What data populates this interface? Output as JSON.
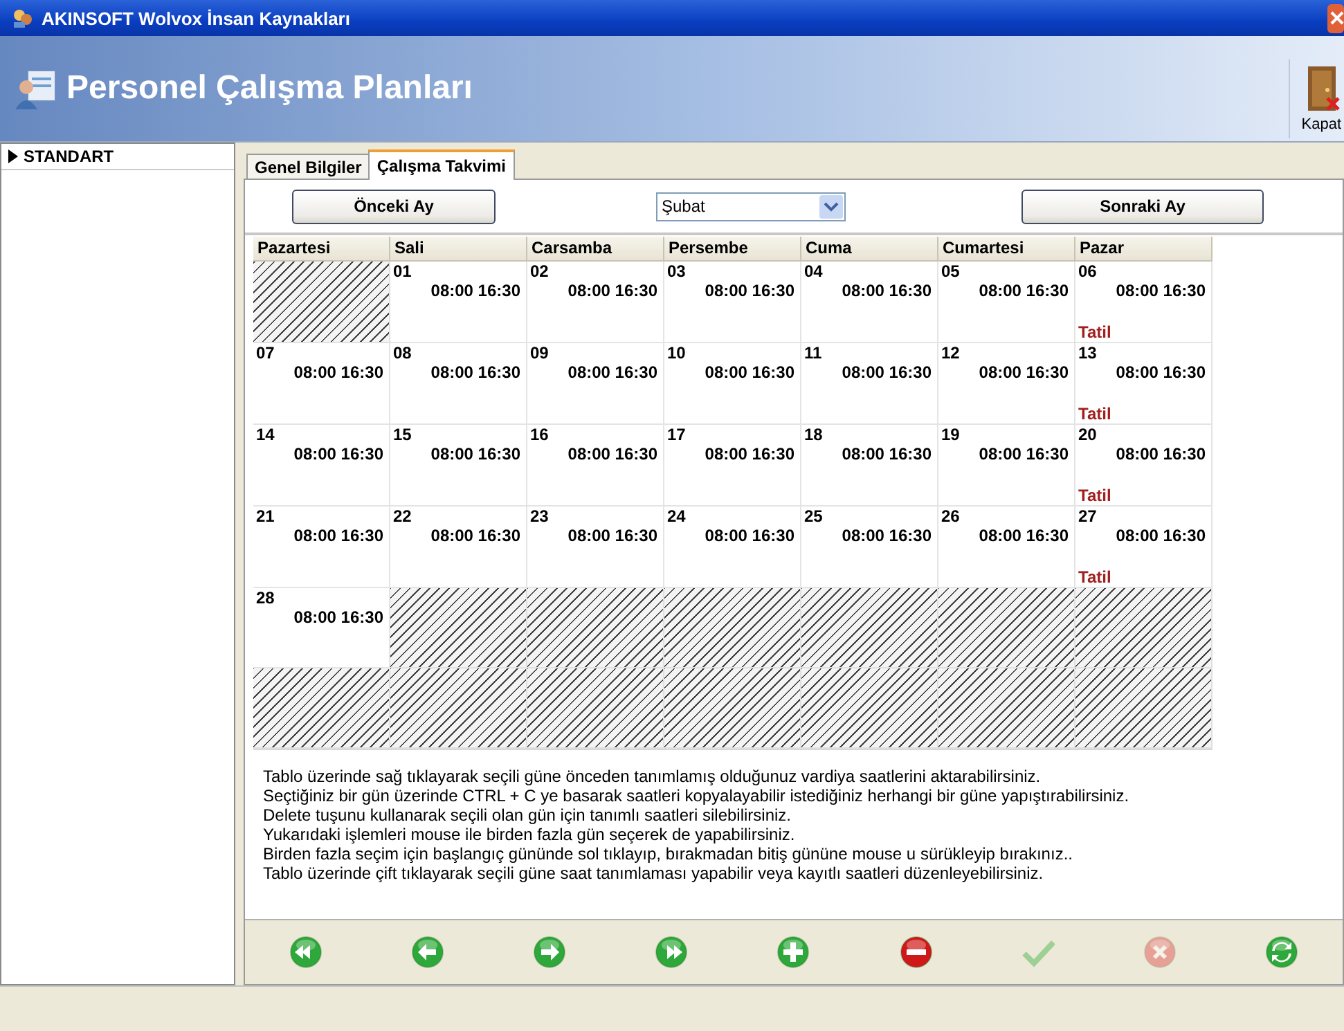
{
  "window": {
    "title": "AKINSOFT Wolvox İnsan Kaynakları"
  },
  "header": {
    "title": "Personel Çalışma Planları",
    "close_label": "Kapat"
  },
  "sidebar": {
    "items": [
      {
        "label": "STANDART",
        "selected": true
      }
    ]
  },
  "tabs": [
    {
      "label": "Genel Bilgiler",
      "selected": false
    },
    {
      "label": "Çalışma Takvimi",
      "selected": true
    }
  ],
  "month_nav": {
    "previous": "Önceki Ay",
    "month": "Şubat",
    "next": "Sonraki Ay"
  },
  "calendar": {
    "columns": [
      "Pazartesi",
      "Sali",
      "Carsamba",
      "Persembe",
      "Cuma",
      "Cumartesi",
      "Pazar"
    ],
    "weeks": [
      [
        {
          "kind": "blank"
        },
        {
          "kind": "day",
          "day": "01",
          "hours": "08:00 16:30"
        },
        {
          "kind": "day",
          "day": "02",
          "hours": "08:00 16:30"
        },
        {
          "kind": "day",
          "day": "03",
          "hours": "08:00 16:30"
        },
        {
          "kind": "day",
          "day": "04",
          "hours": "08:00 16:30"
        },
        {
          "kind": "day",
          "day": "05",
          "hours": "08:00 16:30"
        },
        {
          "kind": "day",
          "day": "06",
          "hours": "08:00 16:30",
          "note": "Tatil"
        }
      ],
      [
        {
          "kind": "day",
          "day": "07",
          "hours": "08:00 16:30"
        },
        {
          "kind": "day",
          "day": "08",
          "hours": "08:00 16:30"
        },
        {
          "kind": "day",
          "day": "09",
          "hours": "08:00 16:30"
        },
        {
          "kind": "day",
          "day": "10",
          "hours": "08:00 16:30"
        },
        {
          "kind": "day",
          "day": "11",
          "hours": "08:00 16:30"
        },
        {
          "kind": "day",
          "day": "12",
          "hours": "08:00 16:30"
        },
        {
          "kind": "day",
          "day": "13",
          "hours": "08:00 16:30",
          "note": "Tatil"
        }
      ],
      [
        {
          "kind": "day",
          "day": "14",
          "hours": "08:00 16:30"
        },
        {
          "kind": "day",
          "day": "15",
          "hours": "08:00 16:30"
        },
        {
          "kind": "day",
          "day": "16",
          "hours": "08:00 16:30"
        },
        {
          "kind": "day",
          "day": "17",
          "hours": "08:00 16:30"
        },
        {
          "kind": "day",
          "day": "18",
          "hours": "08:00 16:30"
        },
        {
          "kind": "day",
          "day": "19",
          "hours": "08:00 16:30"
        },
        {
          "kind": "day",
          "day": "20",
          "hours": "08:00 16:30",
          "note": "Tatil"
        }
      ],
      [
        {
          "kind": "day",
          "day": "21",
          "hours": "08:00 16:30"
        },
        {
          "kind": "day",
          "day": "22",
          "hours": "08:00 16:30"
        },
        {
          "kind": "day",
          "day": "23",
          "hours": "08:00 16:30"
        },
        {
          "kind": "day",
          "day": "24",
          "hours": "08:00 16:30"
        },
        {
          "kind": "day",
          "day": "25",
          "hours": "08:00 16:30"
        },
        {
          "kind": "day",
          "day": "26",
          "hours": "08:00 16:30"
        },
        {
          "kind": "day",
          "day": "27",
          "hours": "08:00 16:30",
          "note": "Tatil"
        }
      ],
      [
        {
          "kind": "day",
          "day": "28",
          "hours": "08:00 16:30"
        },
        {
          "kind": "blank"
        },
        {
          "kind": "blank"
        },
        {
          "kind": "blank"
        },
        {
          "kind": "blank"
        },
        {
          "kind": "blank"
        },
        {
          "kind": "blank"
        }
      ],
      [
        {
          "kind": "blank"
        },
        {
          "kind": "blank"
        },
        {
          "kind": "blank"
        },
        {
          "kind": "blank"
        },
        {
          "kind": "blank"
        },
        {
          "kind": "blank"
        },
        {
          "kind": "blank"
        }
      ]
    ]
  },
  "instructions": [
    "Tablo üzerinde sağ tıklayarak seçili güne önceden tanımlamış olduğunuz vardiya saatlerini aktarabilirsiniz.",
    "Seçtiğiniz bir gün üzerinde CTRL + C ye basarak saatleri kopyalayabilir istediğiniz herhangi bir güne yapıştırabilirsiniz.",
    "Delete tuşunu kullanarak seçili olan gün için tanımlı saatleri silebilirsiniz.",
    "Yukarıdaki işlemleri mouse ile birden fazla gün seçerek de yapabilirsiniz.",
    "Birden fazla seçim için başlangıç gününde sol tıklayıp, bırakmadan bitiş gününe mouse u sürükleyip bırakınız..",
    "Tablo üzerinde çift tıklayarak seçili güne saat tanımlaması yapabilir veya kayıtlı saatleri düzenleyebilirsiniz."
  ],
  "toolbar": [
    {
      "kind": "first",
      "disabled": false
    },
    {
      "kind": "prev",
      "disabled": false
    },
    {
      "kind": "next",
      "disabled": false
    },
    {
      "kind": "last",
      "disabled": false
    },
    {
      "kind": "add",
      "disabled": false
    },
    {
      "kind": "delete",
      "disabled": false
    },
    {
      "kind": "save",
      "disabled": true
    },
    {
      "kind": "cancel",
      "disabled": true
    },
    {
      "kind": "refresh",
      "disabled": false
    }
  ]
}
